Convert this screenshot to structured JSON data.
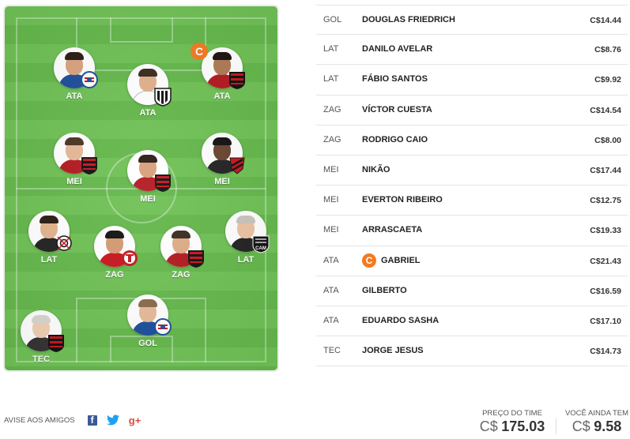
{
  "pitch": {
    "players": [
      {
        "pos": "ATA",
        "team": "bahia",
        "captain": false
      },
      {
        "pos": "ATA",
        "team": "santos",
        "captain": false
      },
      {
        "pos": "ATA",
        "team": "flamengo",
        "captain": true
      },
      {
        "pos": "MEI",
        "team": "flamengo",
        "captain": false
      },
      {
        "pos": "MEI",
        "team": "flamengo",
        "captain": false
      },
      {
        "pos": "MEI",
        "team": "athletico",
        "captain": false
      },
      {
        "pos": "LAT",
        "team": "corinthians",
        "captain": false
      },
      {
        "pos": "ZAG",
        "team": "internacional",
        "captain": false
      },
      {
        "pos": "ZAG",
        "team": "flamengo",
        "captain": false
      },
      {
        "pos": "LAT",
        "team": "atletico-mg",
        "captain": false
      },
      {
        "pos": "GOL",
        "team": "bahia",
        "captain": false
      },
      {
        "pos": "TEC",
        "team": "flamengo",
        "captain": false
      }
    ],
    "captain_label": "C"
  },
  "list": [
    {
      "pos": "GOL",
      "name": "DOUGLAS FRIEDRICH",
      "price": "C$14.44",
      "captain": false
    },
    {
      "pos": "LAT",
      "name": "DANILO AVELAR",
      "price": "C$8.76",
      "captain": false
    },
    {
      "pos": "LAT",
      "name": "FÁBIO SANTOS",
      "price": "C$9.92",
      "captain": false
    },
    {
      "pos": "ZAG",
      "name": "VÍCTOR CUESTA",
      "price": "C$14.54",
      "captain": false
    },
    {
      "pos": "ZAG",
      "name": "RODRIGO CAIO",
      "price": "C$8.00",
      "captain": false
    },
    {
      "pos": "MEI",
      "name": "NIKÃO",
      "price": "C$17.44",
      "captain": false
    },
    {
      "pos": "MEI",
      "name": "EVERTON RIBEIRO",
      "price": "C$12.75",
      "captain": false
    },
    {
      "pos": "MEI",
      "name": "ARRASCAETA",
      "price": "C$19.33",
      "captain": false
    },
    {
      "pos": "ATA",
      "name": "GABRIEL",
      "price": "C$21.43",
      "captain": true
    },
    {
      "pos": "ATA",
      "name": "GILBERTO",
      "price": "C$16.59",
      "captain": false
    },
    {
      "pos": "ATA",
      "name": "EDUARDO SASHA",
      "price": "C$17.10",
      "captain": false
    },
    {
      "pos": "TEC",
      "name": "JORGE JESUS",
      "price": "C$14.73",
      "captain": false
    }
  ],
  "footer": {
    "share_label": "AVISE AOS AMIGOS",
    "share_icons": [
      "facebook-icon",
      "twitter-icon",
      "google-plus-icon"
    ],
    "team_price_label": "PREÇO DO TIME",
    "team_price_currency": "C$",
    "team_price_value": "175.03",
    "remaining_label": "VOCÊ AINDA TEM",
    "remaining_currency": "C$",
    "remaining_value": "9.58"
  },
  "colors": {
    "captain": "#f47a1f",
    "pitch_light": "#6fc155",
    "pitch_dark": "#64b74b",
    "facebook": "#3b5998",
    "twitter": "#1da1f2",
    "google_plus": "#dd4b39"
  }
}
